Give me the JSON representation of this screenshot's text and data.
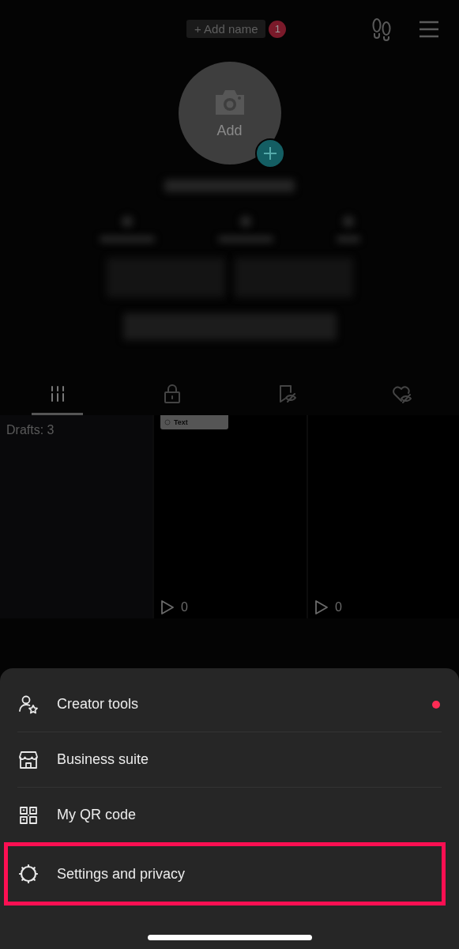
{
  "top_bar": {
    "add_name": "+ Add name",
    "notification_count": "1"
  },
  "avatar": {
    "label": "Add"
  },
  "profile_tabs": [
    {
      "kind": "videos",
      "selected": true
    },
    {
      "kind": "private",
      "selected": false
    },
    {
      "kind": "reposts",
      "selected": false
    },
    {
      "kind": "liked",
      "selected": false
    }
  ],
  "grid": [
    {
      "kind": "drafts",
      "label": "Drafts: 3"
    },
    {
      "kind": "video",
      "chip": "Text",
      "views": "0"
    },
    {
      "kind": "video",
      "views": "0"
    }
  ],
  "menu": [
    {
      "kind": "creator",
      "label": "Creator tools",
      "dot": true,
      "highlighted": false
    },
    {
      "kind": "business",
      "label": "Business suite",
      "dot": false,
      "highlighted": false
    },
    {
      "kind": "qr",
      "label": "My QR code",
      "dot": false,
      "highlighted": false
    },
    {
      "kind": "settings",
      "label": "Settings and privacy",
      "dot": false,
      "highlighted": true
    }
  ]
}
